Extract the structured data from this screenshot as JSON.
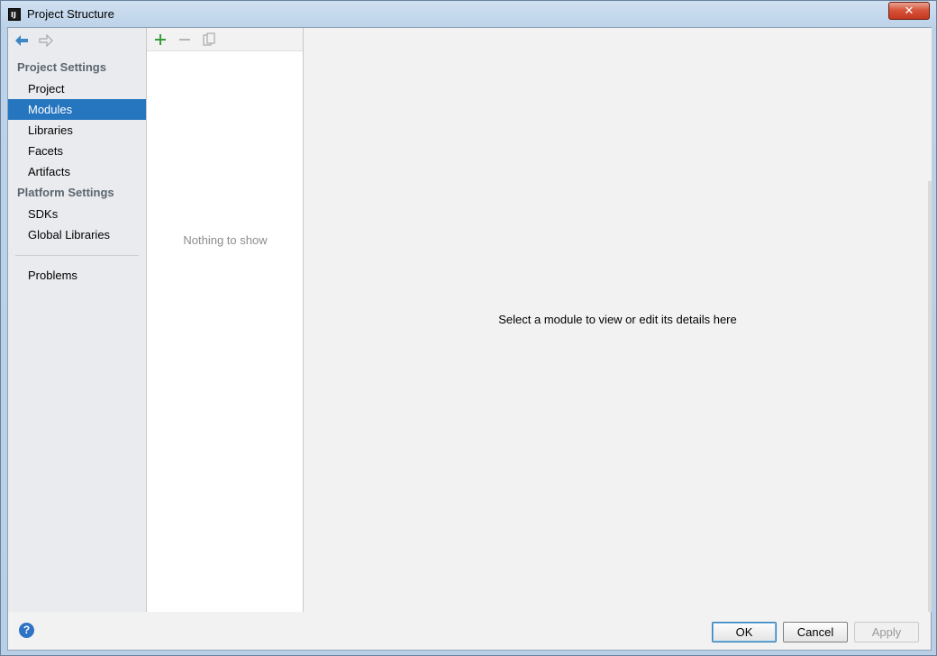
{
  "window": {
    "title": "Project Structure",
    "close_label": "✕"
  },
  "nav": {
    "project_settings_label": "Project Settings",
    "project_items": [
      {
        "label": "Project"
      },
      {
        "label": "Modules",
        "selected": true
      },
      {
        "label": "Libraries"
      },
      {
        "label": "Facets"
      },
      {
        "label": "Artifacts"
      }
    ],
    "platform_settings_label": "Platform Settings",
    "platform_items": [
      {
        "label": "SDKs"
      },
      {
        "label": "Global Libraries"
      }
    ],
    "problems_label": "Problems"
  },
  "list": {
    "empty_text": "Nothing to show"
  },
  "detail": {
    "hint": "Select a module to view or edit its details here"
  },
  "footer": {
    "help_label": "?",
    "ok_label": "OK",
    "cancel_label": "Cancel",
    "apply_label": "Apply"
  },
  "colors": {
    "selection": "#2675bf",
    "add_icon": "#3a9b3a",
    "nav_arrow": "#3f86c6"
  }
}
